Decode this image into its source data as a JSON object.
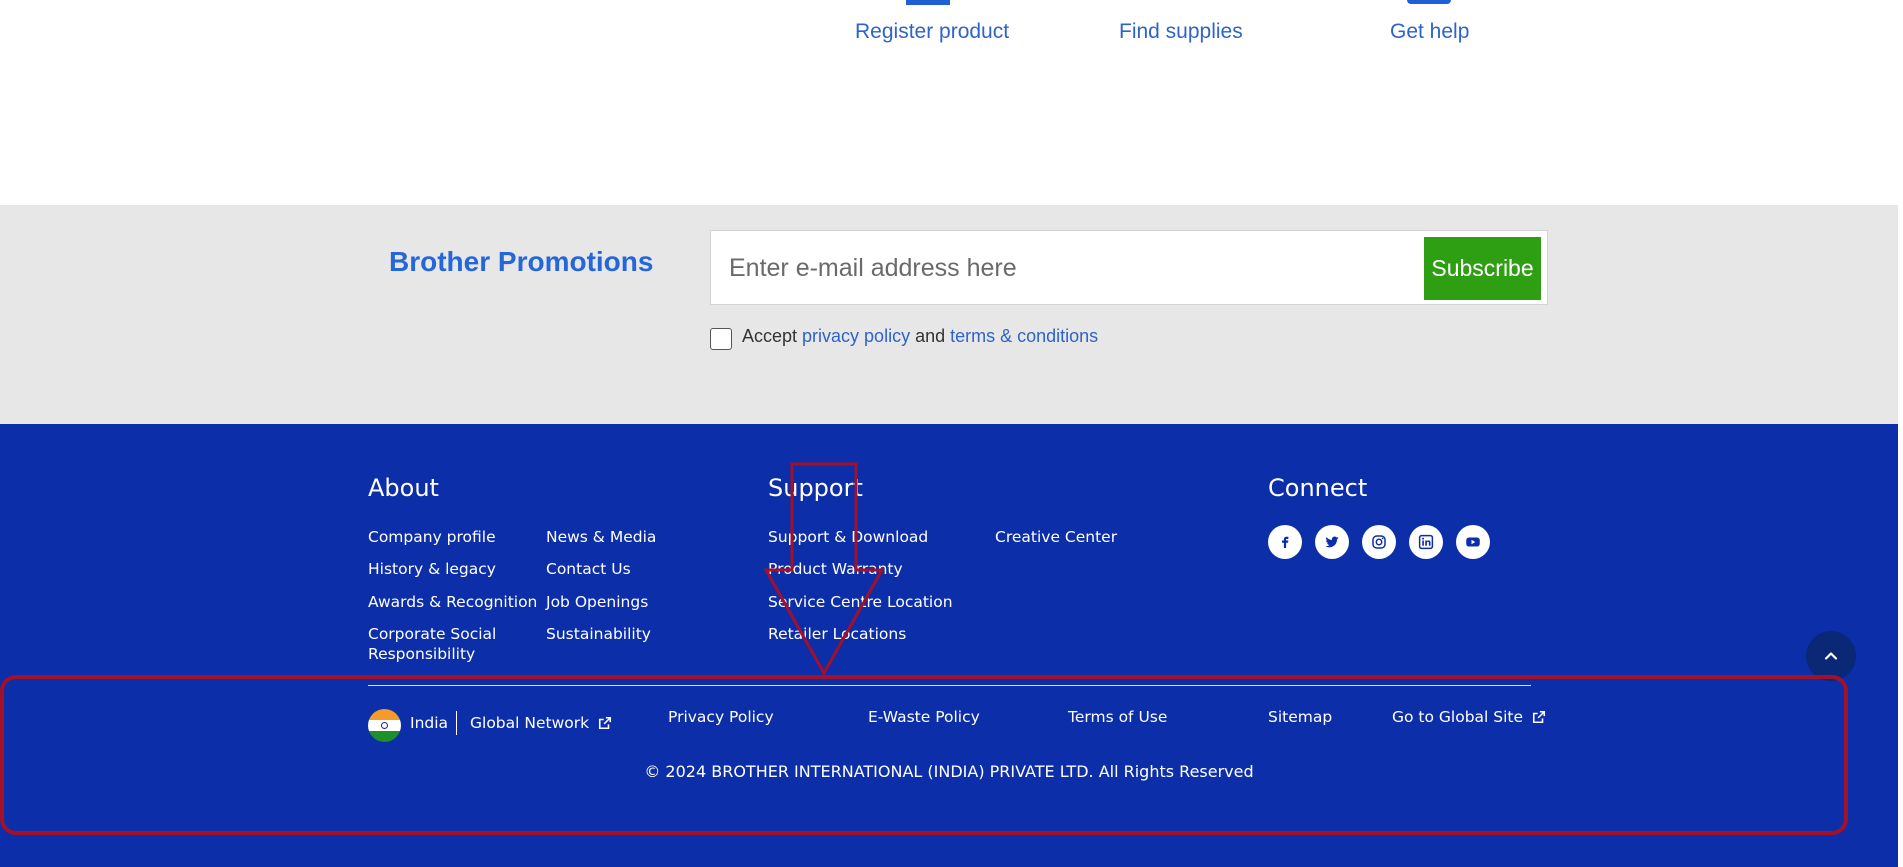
{
  "quick_links": {
    "register": "Register product",
    "supplies": "Find supplies",
    "help": "Get help"
  },
  "promotions": {
    "title": "Brother Promotions",
    "email_placeholder": "Enter e-mail address here",
    "subscribe_label": "Subscribe",
    "accept_prefix": "Accept",
    "privacy_link": "privacy policy",
    "and_text": "and",
    "terms_link": "terms & conditions"
  },
  "footer": {
    "about": {
      "heading": "About",
      "links": [
        "Company profile",
        "History & legacy",
        "Awards & Recognition",
        "Corporate Social",
        "Responsibility",
        "News & Media",
        "Contact Us",
        "Job Openings",
        "Sustainability"
      ]
    },
    "support": {
      "heading": "Support",
      "links": [
        "Support & Download",
        "Product Warranty",
        "Service Centre Location",
        "Retailer Locations",
        "Creative Center"
      ]
    },
    "connect": {
      "heading": "Connect",
      "social": [
        "facebook-icon",
        "twitter-icon",
        "instagram-icon",
        "linkedin-icon",
        "youtube-icon"
      ]
    },
    "bottom": {
      "country": "India",
      "global_network": "Global Network",
      "privacy": "Privacy Policy",
      "ewaste": "E-Waste Policy",
      "terms": "Terms of Use",
      "sitemap": "Sitemap",
      "global_site": "Go to Global Site"
    },
    "copyright": "© 2024 BROTHER INTERNATIONAL (INDIA) PRIVATE LTD. All Rights Reserved"
  },
  "colors": {
    "footer_bg": "#0c2ea8",
    "promo_bg": "#e7e7e7",
    "link_blue": "#2f63c9",
    "subscribe_green": "#2e9e12",
    "annotation_red": "#a3102a"
  }
}
